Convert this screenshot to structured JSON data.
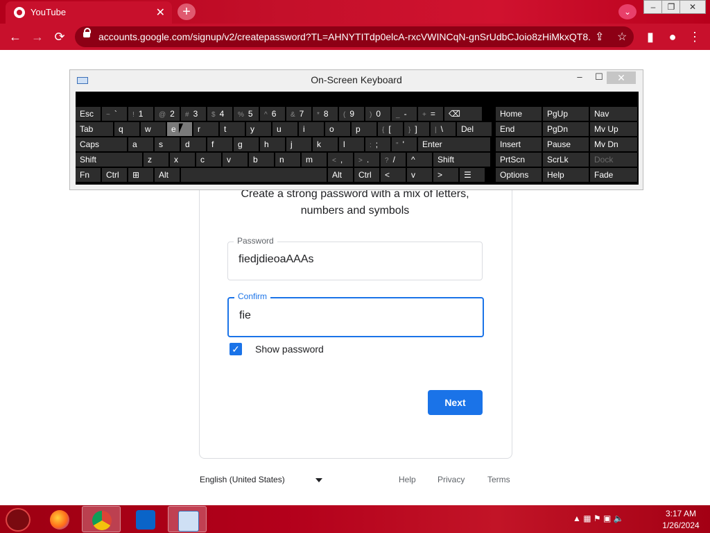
{
  "browser": {
    "tab_title": "YouTube",
    "tab_close": "✕",
    "new_tab": "+",
    "url": "accounts.google.com/signup/v2/createpassword?TL=AHNYTITdp0elcA-rxcVWINCqN-gnSrUdbCJoio8zHiMkxQT8...",
    "back": "←",
    "forward": "→",
    "reload": "⟳",
    "share_icon": "⇪",
    "star_icon": "☆",
    "sidebar_icon": "▮",
    "profile_icon": "●",
    "menu_icon": "⋮",
    "tab_search": "⌄",
    "win_minimize": "–",
    "win_restore": "❐",
    "win_close": "✕"
  },
  "page": {
    "subtitle": "Create a strong password with a mix of letters, numbers and symbols",
    "password_label": "Password",
    "password_value": "fiedjdieoaAAAs",
    "confirm_label": "Confirm",
    "confirm_value": "fie",
    "show_password_label": "Show password",
    "show_password_checked": true,
    "next_label": "Next",
    "footer": {
      "language": "English (United States)",
      "help": "Help",
      "privacy": "Privacy",
      "terms": "Terms"
    }
  },
  "osk": {
    "title": "On-Screen Keyboard",
    "minimize": "–",
    "maximize": "☐",
    "close": "✕",
    "rows": [
      [
        {
          "label": "Esc"
        },
        {
          "shift": "~",
          "label": "`"
        },
        {
          "shift": "!",
          "label": "1"
        },
        {
          "shift": "@",
          "label": "2"
        },
        {
          "shift": "#",
          "label": "3"
        },
        {
          "shift": "$",
          "label": "4"
        },
        {
          "shift": "%",
          "label": "5"
        },
        {
          "shift": "^",
          "label": "6"
        },
        {
          "shift": "&",
          "label": "7"
        },
        {
          "shift": "*",
          "label": "8"
        },
        {
          "shift": "(",
          "label": "9"
        },
        {
          "shift": ")",
          "label": "0"
        },
        {
          "shift": "_",
          "label": "-"
        },
        {
          "shift": "+",
          "label": "="
        },
        {
          "label": "⌫"
        }
      ],
      [
        {
          "label": "Tab"
        },
        {
          "label": "q"
        },
        {
          "label": "w"
        },
        {
          "label": "e"
        },
        {
          "label": "r"
        },
        {
          "label": "t"
        },
        {
          "label": "y"
        },
        {
          "label": "u"
        },
        {
          "label": "i"
        },
        {
          "label": "o"
        },
        {
          "label": "p"
        },
        {
          "shift": "{",
          "label": "["
        },
        {
          "shift": "}",
          "label": "]"
        },
        {
          "shift": "|",
          "label": "\\"
        },
        {
          "label": "Del"
        }
      ],
      [
        {
          "label": "Caps"
        },
        {
          "label": "a"
        },
        {
          "label": "s"
        },
        {
          "label": "d"
        },
        {
          "label": "f"
        },
        {
          "label": "g"
        },
        {
          "label": "h"
        },
        {
          "label": "j"
        },
        {
          "label": "k"
        },
        {
          "label": "l"
        },
        {
          "shift": ":",
          "label": ";"
        },
        {
          "shift": "\"",
          "label": "'"
        },
        {
          "label": "Enter"
        }
      ],
      [
        {
          "label": "Shift"
        },
        {
          "label": "z"
        },
        {
          "label": "x"
        },
        {
          "label": "c"
        },
        {
          "label": "v"
        },
        {
          "label": "b"
        },
        {
          "label": "n"
        },
        {
          "label": "m"
        },
        {
          "shift": "<",
          "label": ","
        },
        {
          "shift": ">",
          "label": "."
        },
        {
          "shift": "?",
          "label": "/"
        },
        {
          "label": "^"
        },
        {
          "label": "Shift"
        }
      ],
      [
        {
          "label": "Fn"
        },
        {
          "label": "Ctrl"
        },
        {
          "label": "⊞"
        },
        {
          "label": "Alt"
        },
        {
          "label": ""
        },
        {
          "label": "Alt"
        },
        {
          "label": "Ctrl"
        },
        {
          "label": "<"
        },
        {
          "label": "v"
        },
        {
          "label": ">"
        },
        {
          "label": "☰"
        }
      ]
    ],
    "nav_keys": [
      [
        "Home",
        "PgUp",
        "Nav"
      ],
      [
        "End",
        "PgDn",
        "Mv Up"
      ],
      [
        "Insert",
        "Pause",
        "Mv Dn"
      ],
      [
        "PrtScn",
        "ScrLk",
        "Dock"
      ],
      [
        "Options",
        "Help",
        "Fade"
      ]
    ]
  },
  "taskbar": {
    "apps": [
      "firefox-icon",
      "chrome-icon",
      "outlook-icon",
      "on-screen-keyboard-icon"
    ],
    "tray": "▲  ▦  ⚑  ▣  🔈",
    "time": "3:17 AM",
    "date": "1/26/2024"
  },
  "colors": {
    "accent": "#1a73e8",
    "chrome_theme": "#c8102c",
    "osk_key": "#2d2d2d"
  }
}
